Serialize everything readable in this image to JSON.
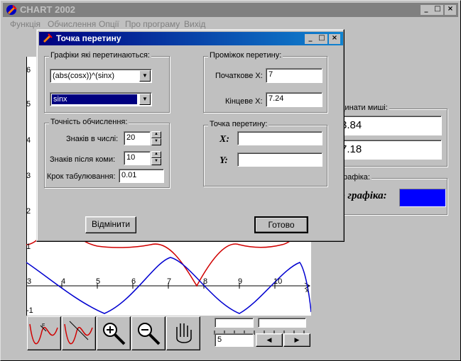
{
  "app": {
    "title": "CHART 2002",
    "menu": [
      "Функція",
      "Обчислення",
      "Опції",
      "Про програму",
      "Вихід"
    ],
    "window_buttons": [
      "_",
      "□",
      "×"
    ]
  },
  "graph": {
    "y_ticks": [
      "6",
      "5",
      "4",
      "3",
      "2",
      "1",
      "-1"
    ],
    "x_ticks": [
      "3",
      "4",
      "5",
      "6",
      "7",
      "8",
      "9",
      "10"
    ],
    "x_axis_label": "x"
  },
  "right_panel": {
    "coords_legend": "динати миші:",
    "coord_x": "3.84",
    "coord_y": "7.18",
    "color_legend": "графіка:",
    "color_label": "ір графіка:",
    "graph_color": "#0000ff"
  },
  "bottom": {
    "stepper_value": "5",
    "tools": [
      "zoom-in",
      "zoom-out",
      "hand-pan"
    ]
  },
  "dialog": {
    "title": "Точка перетину",
    "graphs_legend": "Графіки які перетинаються:",
    "func1": "(abs(cosx))^(sinx)",
    "func2": "sinx",
    "interval_legend": "Проміжок перетину:",
    "start_label": "Початкове X:",
    "start_value": "7",
    "end_label": "Кінцеве X:",
    "end_value": "7.24",
    "precision_legend": "Точність обчислення:",
    "digits_label": "Знаків в числі:",
    "digits_value": "20",
    "decimals_label": "Знаків після коми:",
    "decimals_value": "10",
    "step_label": "Крок табулювання:",
    "step_value": "0.01",
    "point_legend": "Точка перетину:",
    "x_label": "X:",
    "y_label": "Y:",
    "x_result": "",
    "y_result": "",
    "cancel_label": "Відмінити",
    "ok_label": "Готово"
  }
}
